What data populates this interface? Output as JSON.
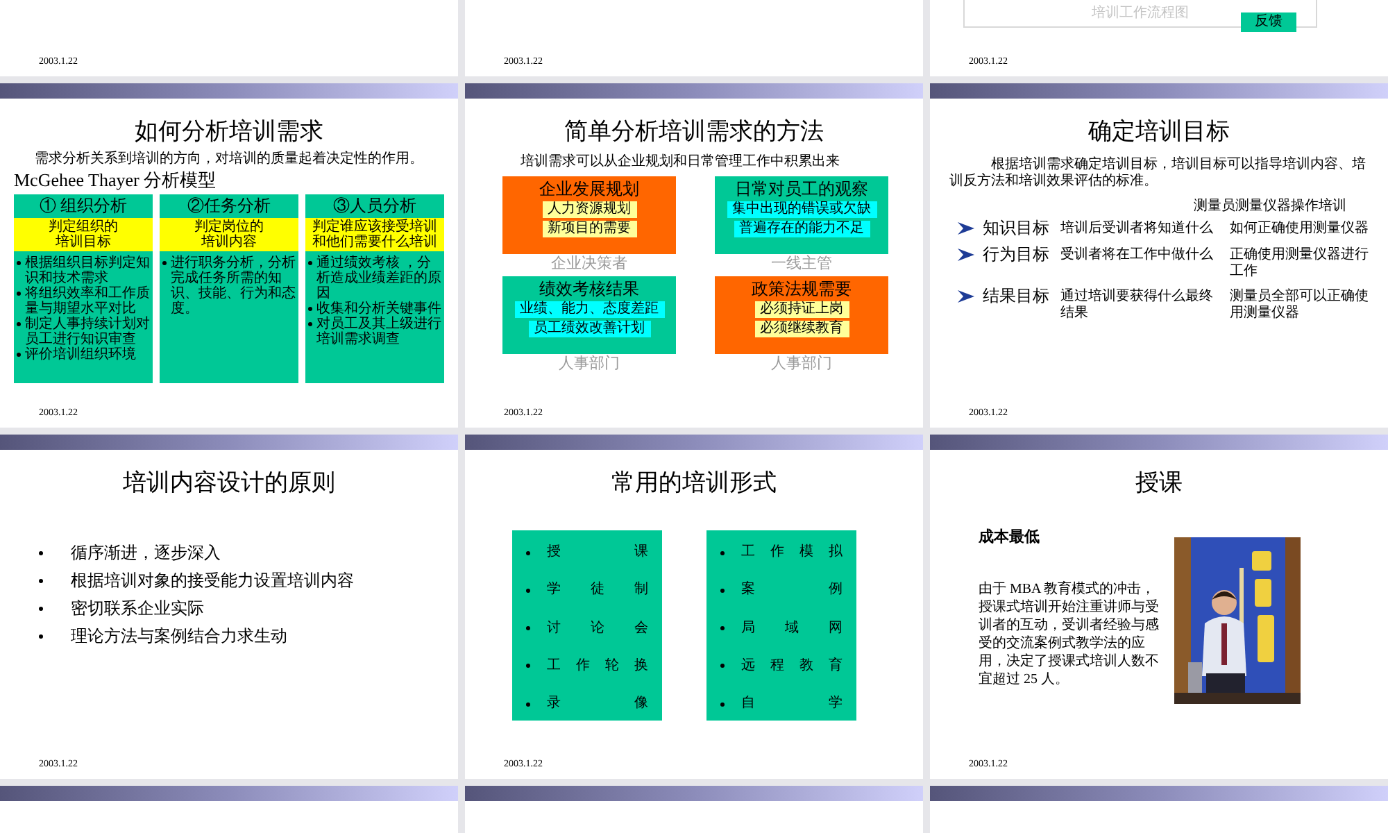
{
  "slides": [
    {
      "kind": "footer-only",
      "date": "2003.1.22"
    },
    {
      "kind": "footer-only",
      "date": "2003.1.22"
    },
    {
      "kind": "flowchart-tail",
      "caption": "培训工作流程图",
      "feedback": "反馈",
      "date": "2003.1.22"
    },
    {
      "kind": "model-analysis",
      "title": "如何分析培训需求",
      "intro": "需求分析关系到培训的方向，对培训的质量起着决定性的作用。",
      "model_title": "McGehee Thayer 分析模型",
      "columns": [
        {
          "heading": "① 组织分析",
          "highlight": [
            "判定组织的",
            "培训目标"
          ],
          "bullets": [
            "根据组织目标判定知识和技术需求",
            "将组织效率和工作质量与期望水平对比",
            "制定人事持续计划对员工进行知识审查",
            "评价培训组织环境"
          ]
        },
        {
          "heading": "②任务分析",
          "highlight": [
            "判定岗位的",
            "培训内容"
          ],
          "bullets": [
            "进行职务分析，分析完成任务所需的知识、技能、行为和态度。"
          ]
        },
        {
          "heading": "③人员分析",
          "highlight": [
            "判定谁应该接受培训",
            "和他们需要什么培训"
          ],
          "bullets": [
            "通过绩效考核 ，分析造成业绩差距的原因",
            "收集和分析关键事件",
            "对员工及其上级进行培训需求调查"
          ]
        }
      ],
      "date": "2003.1.22"
    },
    {
      "kind": "source-grid",
      "title": "简单分析培训需求的方法",
      "intro": "培训需求可以从企业规划和日常管理工作中积累出来",
      "boxes": [
        {
          "title": "企业发展规划",
          "color": "#ff6600",
          "items": [
            {
              "text": "人力资源规划",
              "color": "#ffff99"
            },
            {
              "text": "新项目的需要",
              "color": "#ffff99"
            }
          ],
          "caption": "企业决策者"
        },
        {
          "title": "日常对员工的观察",
          "color": "#00c896",
          "items": [
            {
              "text": "集中出现的错误或欠缺",
              "color": "#00ffff"
            },
            {
              "text": "普遍存在的能力不足",
              "color": "#00ffff"
            }
          ],
          "caption": "一线主管"
        },
        {
          "title": "绩效考核结果",
          "color": "#00c896",
          "items": [
            {
              "text": "业绩、能力、态度差距",
              "color": "#00ffff"
            },
            {
              "text": "员工绩效改善计划",
              "color": "#00ffff"
            }
          ],
          "caption": "人事部门"
        },
        {
          "title": "政策法规需要",
          "color": "#ff6600",
          "items": [
            {
              "text": "必须持证上岗",
              "color": "#ffff99"
            },
            {
              "text": "必须继续教育",
              "color": "#ffff99"
            }
          ],
          "caption": "人事部门"
        }
      ],
      "date": "2003.1.22"
    },
    {
      "kind": "objectives",
      "title": "确定培训目标",
      "intro": "根据培训需求确定培训目标，培训目标可以指导培训内容、培训反方法和培训效果评估的标准。",
      "example_heading": "测量员测量仪器操作培训",
      "rows": [
        {
          "goal": "知识目标",
          "question": "培训后受训者将知道什么",
          "example": "如何正确使用测量仪器"
        },
        {
          "goal": "行为目标",
          "question": "受训者将在工作中做什么",
          "example": "正确使用测量仪器进行工作"
        },
        {
          "goal": "结果目标",
          "question": "通过培训要获得什么最终结果",
          "example": "测量员全部可以正确使用测量仪器"
        }
      ],
      "date": "2003.1.22"
    },
    {
      "kind": "bullets",
      "title": "培训内容设计的原则",
      "bullets": [
        "循序渐进，逐步深入",
        "根据培训对象的接受能力设置培训内容",
        "密切联系企业实际",
        "理论方法与案例结合力求生动"
      ],
      "date": "2003.1.22"
    },
    {
      "kind": "two-lists",
      "title": "常用的培训形式",
      "lists": [
        [
          "授课",
          "学徒制",
          "讨论会",
          "工作轮换",
          "录像"
        ],
        [
          "工作模拟",
          "案例",
          "局域网",
          "远程教育",
          "自学"
        ]
      ],
      "date": "2003.1.22"
    },
    {
      "kind": "text-photo",
      "title": "授课",
      "subtitle": "成本最低",
      "paragraph": "由于 MBA 教育模式的冲击，授课式培训开始注重讲师与受训者的互动，受训者经验与感受的交流案例式教学法的应用，决定了授课式培训人数不宜超过 25 人。",
      "date": "2003.1.22"
    },
    {
      "kind": "blank"
    },
    {
      "kind": "blank"
    },
    {
      "kind": "blank"
    }
  ]
}
